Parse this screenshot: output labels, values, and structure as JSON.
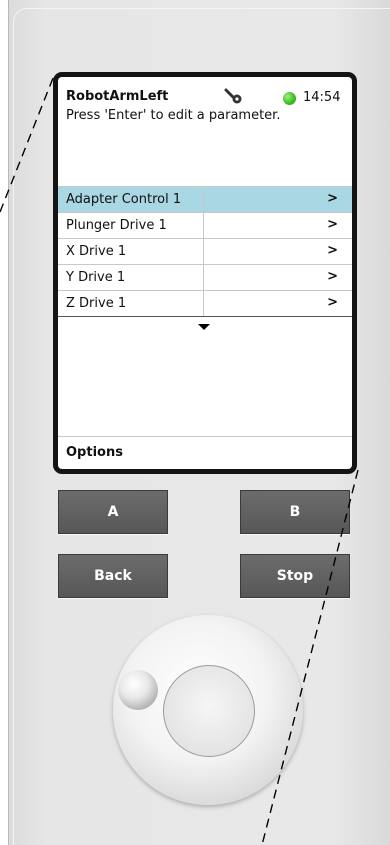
{
  "screen": {
    "title": "RobotArmLeft",
    "time": "14:54",
    "instruction": "Press 'Enter' to edit a parameter.",
    "menu_items": [
      {
        "label": "Adapter Control 1",
        "arrow": ">",
        "selected": true
      },
      {
        "label": "Plunger Drive 1",
        "arrow": ">",
        "selected": false
      },
      {
        "label": "X Drive 1",
        "arrow": ">",
        "selected": false
      },
      {
        "label": "Y Drive 1",
        "arrow": ">",
        "selected": false
      },
      {
        "label": "Z Drive 1",
        "arrow": ">",
        "selected": false
      }
    ],
    "options_label": "Options",
    "status_led_color": "#3fbf2a",
    "selected_row_color": "#a9d7e4"
  },
  "hardware_buttons": {
    "a_label": "A",
    "b_label": "B",
    "back_label": "Back",
    "stop_label": "Stop"
  },
  "icons": [
    "wrench-icon",
    "status-led-icon",
    "scroll-down-icon",
    "jog-dial"
  ]
}
